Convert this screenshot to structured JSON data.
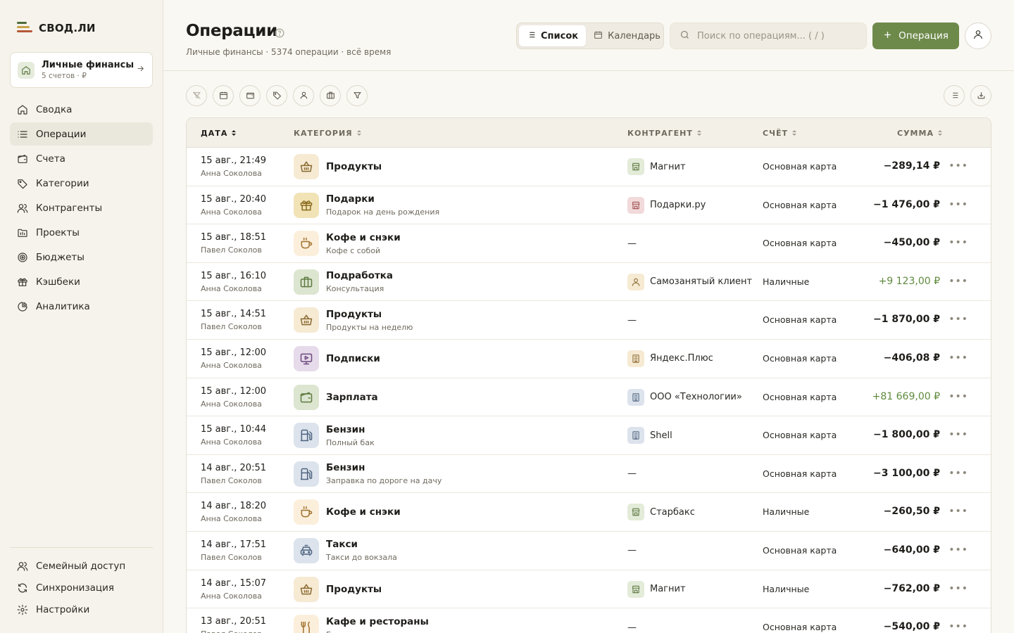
{
  "app": {
    "logo_text": "СВОД.ЛИ"
  },
  "workspace": {
    "title": "Личные финансы",
    "subtitle": "5 счетов · ₽"
  },
  "nav": [
    {
      "label": "Сводка",
      "icon": "home-icon",
      "active": false
    },
    {
      "label": "Операции",
      "icon": "list-icon",
      "active": true
    },
    {
      "label": "Счета",
      "icon": "wallet-icon",
      "active": false
    },
    {
      "label": "Категории",
      "icon": "tag-icon",
      "active": false
    },
    {
      "label": "Контрагенты",
      "icon": "users-icon",
      "active": false
    },
    {
      "label": "Проекты",
      "icon": "folder-icon",
      "active": false
    },
    {
      "label": "Бюджеты",
      "icon": "target-icon",
      "active": false
    },
    {
      "label": "Кэшбеки",
      "icon": "gift-icon",
      "active": false
    },
    {
      "label": "Аналитика",
      "icon": "pie-chart-icon",
      "active": false
    }
  ],
  "nav_bottom": [
    {
      "label": "Семейный доступ",
      "icon": "family-icon"
    },
    {
      "label": "Синхронизация",
      "icon": "sync-icon"
    },
    {
      "label": "Настройки",
      "icon": "gear-icon"
    }
  ],
  "header": {
    "title": "Операции",
    "subtitle": "Личные финансы · 5374 операции · всё время",
    "view_list": "Список",
    "view_calendar": "Календарь",
    "search_placeholder": "Поиск по операциям... ( / )",
    "add_button": "Операция"
  },
  "table": {
    "columns": {
      "date": "ДАТА",
      "category": "КАТЕГОРИЯ",
      "counterparty": "КОНТРАГЕНТ",
      "account": "СЧЁТ",
      "amount": "СУММА"
    },
    "rows": [
      {
        "time": "15 авг., 21:49",
        "user": "Анна Соколова",
        "category": "Продукты",
        "note": "",
        "cat_icon": "basket-icon",
        "cat_bg": "#F6EAD3",
        "cat_fg": "#8A6A32",
        "counterparty": "Магнит",
        "cp_icon": "store-icon",
        "cp_bg": "#E3EBD9",
        "cp_fg": "#5E7A42",
        "account": "Основная карта",
        "amount": "−289,14 ₽",
        "positive": false
      },
      {
        "time": "15 авг., 20:40",
        "user": "Анна Соколова",
        "category": "Подарки",
        "note": "Подарок на день рождения",
        "cat_icon": "gift-icon",
        "cat_bg": "#F1E3B6",
        "cat_fg": "#8A6A1E",
        "counterparty": "Подарки.ру",
        "cp_icon": "store-icon",
        "cp_bg": "#F2DADA",
        "cp_fg": "#A05050",
        "account": "Основная карта",
        "amount": "−1 476,00 ₽",
        "positive": false
      },
      {
        "time": "15 авг., 18:51",
        "user": "Павел Соколов",
        "category": "Кофе и снэки",
        "note": "Кофе с собой",
        "cat_icon": "cup-icon",
        "cat_bg": "#FBEFDC",
        "cat_fg": "#A0712E",
        "counterparty": "—",
        "cp_icon": "",
        "account": "Основная карта",
        "amount": "−450,00 ₽",
        "positive": false
      },
      {
        "time": "15 авг., 16:10",
        "user": "Анна Соколова",
        "category": "Подработка",
        "note": "Консультация",
        "cat_icon": "briefcase-icon",
        "cat_bg": "#DCE5CF",
        "cat_fg": "#5E7A42",
        "counterparty": "Самозанятый клиент",
        "cp_icon": "person-icon",
        "cp_bg": "#F6EAD3",
        "cp_fg": "#8A6A32",
        "account": "Наличные",
        "amount": "+9 123,00 ₽",
        "positive": true
      },
      {
        "time": "15 авг., 14:51",
        "user": "Павел Соколов",
        "category": "Продукты",
        "note": "Продукты на неделю",
        "cat_icon": "basket-icon",
        "cat_bg": "#F6EAD3",
        "cat_fg": "#8A6A32",
        "counterparty": "—",
        "cp_icon": "",
        "account": "Основная карта",
        "amount": "−1 870,00 ₽",
        "positive": false
      },
      {
        "time": "15 авг., 12:00",
        "user": "Анна Соколова",
        "category": "Подписки",
        "note": "",
        "cat_icon": "monitor-icon",
        "cat_bg": "#E6DBEA",
        "cat_fg": "#6E4A80",
        "counterparty": "Яндекс.Плюс",
        "cp_icon": "building-icon",
        "cp_bg": "#F6EAD3",
        "cp_fg": "#8A6A32",
        "account": "Основная карта",
        "amount": "−406,08 ₽",
        "positive": false
      },
      {
        "time": "15 авг., 12:00",
        "user": "Анна Соколова",
        "category": "Зарплата",
        "note": "",
        "cat_icon": "wallet-icon",
        "cat_bg": "#DCE5CF",
        "cat_fg": "#5E7A42",
        "counterparty": "ООО «Технологии»",
        "cp_icon": "building-icon",
        "cp_bg": "#DCE3EC",
        "cp_fg": "#4E6480",
        "account": "Основная карта",
        "amount": "+81 669,00 ₽",
        "positive": true
      },
      {
        "time": "15 авг., 10:44",
        "user": "Анна Соколова",
        "category": "Бензин",
        "note": "Полный бак",
        "cat_icon": "fuel-icon",
        "cat_bg": "#DCE3EC",
        "cat_fg": "#4E6480",
        "counterparty": "Shell",
        "cp_icon": "building-icon",
        "cp_bg": "#DCE3EC",
        "cp_fg": "#4E6480",
        "account": "Основная карта",
        "amount": "−1 800,00 ₽",
        "positive": false
      },
      {
        "time": "14 авг., 20:51",
        "user": "Павел Соколов",
        "category": "Бензин",
        "note": "Заправка по дороге на дачу",
        "cat_icon": "fuel-icon",
        "cat_bg": "#DCE3EC",
        "cat_fg": "#4E6480",
        "counterparty": "—",
        "cp_icon": "",
        "account": "Основная карта",
        "amount": "−3 100,00 ₽",
        "positive": false
      },
      {
        "time": "14 авг., 18:20",
        "user": "Анна Соколова",
        "category": "Кофе и снэки",
        "note": "",
        "cat_icon": "cup-icon",
        "cat_bg": "#FBEFDC",
        "cat_fg": "#A0712E",
        "counterparty": "Старбакс",
        "cp_icon": "store-icon",
        "cp_bg": "#E3EBD9",
        "cp_fg": "#5E7A42",
        "account": "Наличные",
        "amount": "−260,50 ₽",
        "positive": false
      },
      {
        "time": "14 авг., 17:51",
        "user": "Павел Соколов",
        "category": "Такси",
        "note": "Такси до вокзала",
        "cat_icon": "car-icon",
        "cat_bg": "#DCE3EC",
        "cat_fg": "#4E6480",
        "counterparty": "—",
        "cp_icon": "",
        "account": "Основная карта",
        "amount": "−640,00 ₽",
        "positive": false
      },
      {
        "time": "14 авг., 15:07",
        "user": "Анна Соколова",
        "category": "Продукты",
        "note": "",
        "cat_icon": "basket-icon",
        "cat_bg": "#F6EAD3",
        "cat_fg": "#8A6A32",
        "counterparty": "Магнит",
        "cp_icon": "store-icon",
        "cp_bg": "#E3EBD9",
        "cp_fg": "#5E7A42",
        "account": "Наличные",
        "amount": "−762,00 ₽",
        "positive": false
      },
      {
        "time": "13 авг., 20:51",
        "user": "Павел Соколов",
        "category": "Кафе и рестораны",
        "note": "Бизнес-ланч",
        "cat_icon": "fork-knife-icon",
        "cat_bg": "#FBEFDC",
        "cat_fg": "#A0712E",
        "counterparty": "—",
        "cp_icon": "",
        "account": "Основная карта",
        "amount": "−540,00 ₽",
        "positive": false
      }
    ]
  },
  "colors": {
    "accent": "#6E8A4B",
    "positive": "#5F8A3C",
    "sidebar_bg": "#F6F3EC",
    "page_bg": "#FAF8F3"
  }
}
